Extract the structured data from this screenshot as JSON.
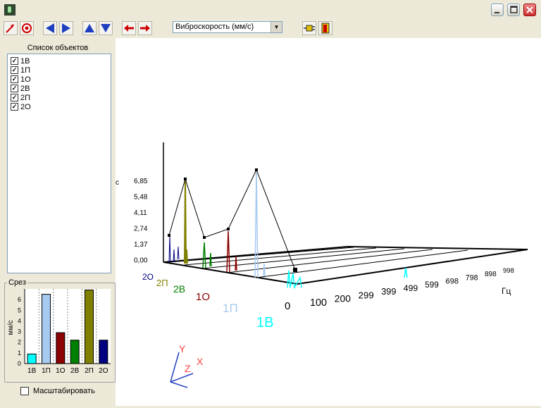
{
  "window": {
    "title": ""
  },
  "toolbar": {
    "select_value": "Виброскорость (мм/с)"
  },
  "objects_panel": {
    "title": "Список объектов",
    "items": [
      {
        "label": "1В",
        "checked": true
      },
      {
        "label": "1П",
        "checked": true
      },
      {
        "label": "1О",
        "checked": true
      },
      {
        "label": "2В",
        "checked": true
      },
      {
        "label": "2П",
        "checked": true
      },
      {
        "label": "2О",
        "checked": true
      }
    ]
  },
  "slice": {
    "title": "Срез",
    "ylabel": "мм/с",
    "yticks": [
      "0",
      "1",
      "2",
      "3",
      "4",
      "5",
      "6"
    ],
    "scale_checkbox": "Масштабировать",
    "chart_data": {
      "type": "bar",
      "categories": [
        "1В",
        "1П",
        "1О",
        "2В",
        "2П",
        "2О"
      ],
      "values": [
        0.9,
        6.5,
        2.9,
        2.2,
        6.9,
        2.2
      ],
      "colors": [
        "#00ffff",
        "#a6caf0",
        "#8b0000",
        "#008000",
        "#808000",
        "#000080"
      ],
      "ylabel": "мм/с",
      "ylim": [
        0,
        7
      ]
    }
  },
  "plot3d": {
    "unit_fragment": "с",
    "zticks": [
      "6,85",
      "5,48",
      "4,11",
      "2,74",
      "1,37",
      "0,00"
    ],
    "freq_ticks": [
      "0",
      "100",
      "200",
      "299",
      "399",
      "499",
      "599",
      "698",
      "798",
      "898",
      "998"
    ],
    "freq_unit": "Гц",
    "series_labels": [
      {
        "label": "2О",
        "color": "#000080"
      },
      {
        "label": "2П",
        "color": "#808000"
      },
      {
        "label": "2В",
        "color": "#008000"
      },
      {
        "label": "1О",
        "color": "#8b0000"
      },
      {
        "label": "1П",
        "color": "#a6caf0"
      },
      {
        "label": "1В",
        "color": "#00ffff"
      }
    ],
    "axes": {
      "x": "X",
      "y": "Y",
      "z": "Z"
    }
  }
}
